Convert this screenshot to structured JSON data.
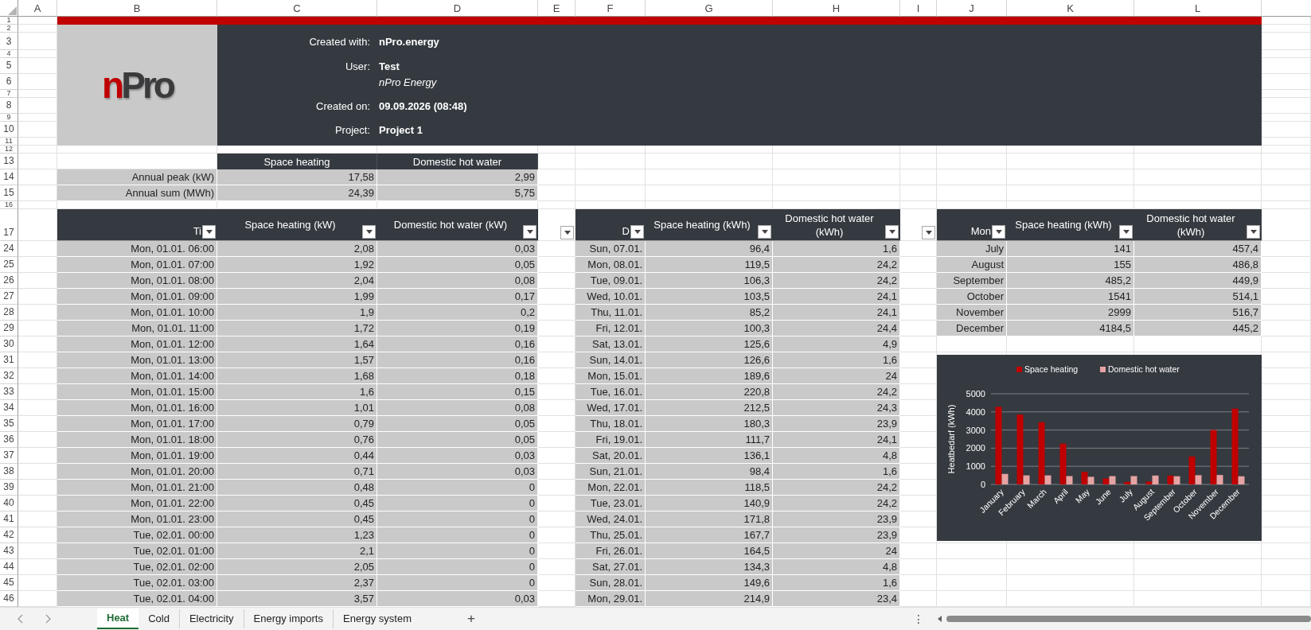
{
  "column_headers": [
    "A",
    "B",
    "C",
    "D",
    "E",
    "F",
    "G",
    "H",
    "I",
    "J",
    "K",
    "L"
  ],
  "row_numbers": [
    "1",
    "2",
    "3",
    "4",
    "5",
    "6",
    "7",
    "8",
    "9",
    "10",
    "11",
    "12",
    "13",
    "14",
    "15",
    "16",
    "17",
    "24",
    "25",
    "26",
    "27",
    "28",
    "29",
    "30",
    "31",
    "32",
    "33",
    "34",
    "35",
    "36",
    "37",
    "38",
    "39",
    "40",
    "41",
    "42",
    "43",
    "44",
    "45",
    "46"
  ],
  "logo": {
    "accent": "n",
    "rest": "Pro"
  },
  "info": [
    {
      "kind": "field",
      "label": "Created with:",
      "value": "nPro.energy"
    },
    {
      "kind": "field",
      "label": "User:",
      "value": "Test"
    },
    {
      "kind": "note",
      "value": "nPro Energy"
    },
    {
      "kind": "field",
      "label": "Created on:",
      "value": "09.09.2026 (08:48)"
    },
    {
      "kind": "field",
      "label": "Project:",
      "value": "Project 1"
    }
  ],
  "summary": {
    "columns": [
      "Space heating",
      "Domestic hot water"
    ],
    "rows": [
      {
        "label": "Annual peak (kW)",
        "values": [
          "17,58",
          "2,99"
        ]
      },
      {
        "label": "Annual sum (MWh)",
        "values": [
          "24,39",
          "5,75"
        ]
      }
    ]
  },
  "tables": [
    {
      "columns": [
        {
          "kind": "header",
          "label": "Ti"
        },
        {
          "kind": "header",
          "label": "Space heating (kW)"
        },
        {
          "kind": "header",
          "label": "Domestic hot water (kW)"
        },
        {
          "kind": "filter"
        }
      ],
      "rows": [
        [
          "Mon, 01.01. 06:00",
          "2,08",
          "0,03"
        ],
        [
          "Mon, 01.01. 07:00",
          "1,92",
          "0,05"
        ],
        [
          "Mon, 01.01. 08:00",
          "2,04",
          "0,08"
        ],
        [
          "Mon, 01.01. 09:00",
          "1,99",
          "0,17"
        ],
        [
          "Mon, 01.01. 10:00",
          "1,9",
          "0,2"
        ],
        [
          "Mon, 01.01. 11:00",
          "1,72",
          "0,19"
        ],
        [
          "Mon, 01.01. 12:00",
          "1,64",
          "0,16"
        ],
        [
          "Mon, 01.01. 13:00",
          "1,57",
          "0,16"
        ],
        [
          "Mon, 01.01. 14:00",
          "1,68",
          "0,18"
        ],
        [
          "Mon, 01.01. 15:00",
          "1,6",
          "0,15"
        ],
        [
          "Mon, 01.01. 16:00",
          "1,01",
          "0,08"
        ],
        [
          "Mon, 01.01. 17:00",
          "0,79",
          "0,05"
        ],
        [
          "Mon, 01.01. 18:00",
          "0,76",
          "0,05"
        ],
        [
          "Mon, 01.01. 19:00",
          "0,44",
          "0,03"
        ],
        [
          "Mon, 01.01. 20:00",
          "0,71",
          "0,03"
        ],
        [
          "Mon, 01.01. 21:00",
          "0,48",
          "0"
        ],
        [
          "Mon, 01.01. 22:00",
          "0,45",
          "0"
        ],
        [
          "Mon, 01.01. 23:00",
          "0,45",
          "0"
        ],
        [
          "Tue, 02.01. 00:00",
          "1,23",
          "0"
        ],
        [
          "Tue, 02.01. 01:00",
          "2,1",
          "0"
        ],
        [
          "Tue, 02.01. 02:00",
          "2,05",
          "0"
        ],
        [
          "Tue, 02.01. 03:00",
          "2,37",
          "0"
        ],
        [
          "Tue, 02.01. 04:00",
          "3,57",
          "0,03"
        ]
      ]
    },
    {
      "columns": [
        {
          "kind": "header",
          "label": "D"
        },
        {
          "kind": "header",
          "label": "Space heating (kWh)"
        },
        {
          "kind": "header",
          "label": "Domestic hot water (kWh)"
        },
        {
          "kind": "filter"
        }
      ],
      "rows": [
        [
          "Sun, 07.01.",
          "96,4",
          "1,6"
        ],
        [
          "Mon, 08.01.",
          "119,5",
          "24,2"
        ],
        [
          "Tue, 09.01.",
          "106,3",
          "24,2"
        ],
        [
          "Wed, 10.01.",
          "103,5",
          "24,1"
        ],
        [
          "Thu, 11.01.",
          "85,2",
          "24,1"
        ],
        [
          "Fri, 12.01.",
          "100,3",
          "24,4"
        ],
        [
          "Sat, 13.01.",
          "125,6",
          "4,9"
        ],
        [
          "Sun, 14.01.",
          "126,6",
          "1,6"
        ],
        [
          "Mon, 15.01.",
          "189,6",
          "24"
        ],
        [
          "Tue, 16.01.",
          "220,8",
          "24,2"
        ],
        [
          "Wed, 17.01.",
          "212,5",
          "24,3"
        ],
        [
          "Thu, 18.01.",
          "180,3",
          "23,9"
        ],
        [
          "Fri, 19.01.",
          "111,7",
          "24,1"
        ],
        [
          "Sat, 20.01.",
          "136,1",
          "4,8"
        ],
        [
          "Sun, 21.01.",
          "98,4",
          "1,6"
        ],
        [
          "Mon, 22.01.",
          "118,5",
          "24,2"
        ],
        [
          "Tue, 23.01.",
          "140,9",
          "24,2"
        ],
        [
          "Wed, 24.01.",
          "171,8",
          "23,9"
        ],
        [
          "Thu, 25.01.",
          "167,7",
          "23,9"
        ],
        [
          "Fri, 26.01.",
          "164,5",
          "24"
        ],
        [
          "Sat, 27.01.",
          "134,3",
          "4,8"
        ],
        [
          "Sun, 28.01.",
          "149,6",
          "1,6"
        ],
        [
          "Mon, 29.01.",
          "214,9",
          "23,4"
        ]
      ]
    },
    {
      "columns": [
        {
          "kind": "header",
          "label": "Mon"
        },
        {
          "kind": "header",
          "label": "Space heating (kWh)"
        },
        {
          "kind": "header",
          "label": "Domestic hot water (kWh)"
        }
      ],
      "rows": [
        [
          "July",
          "141",
          "457,4"
        ],
        [
          "August",
          "155",
          "486,8"
        ],
        [
          "September",
          "485,2",
          "449,9"
        ],
        [
          "October",
          "1541",
          "514,1"
        ],
        [
          "November",
          "2999",
          "516,7"
        ],
        [
          "December",
          "4184,5",
          "445,2"
        ]
      ]
    }
  ],
  "chart": {
    "chart_data": {
      "type": "bar",
      "ylabel": "Heatbedarf (kWh)",
      "grid": true,
      "legend": true,
      "categories": [
        "January",
        "February",
        "March",
        "April",
        "May",
        "June",
        "July",
        "August",
        "September",
        "October",
        "November",
        "December"
      ],
      "series": [
        {
          "name": "Space heating",
          "color": "#c00000",
          "values": [
            4280,
            3850,
            3430,
            2250,
            690,
            330,
            140,
            160,
            490,
            1540,
            3000,
            4180
          ]
        },
        {
          "name": "Domestic hot water",
          "color": "#e6a3a3",
          "values": [
            580,
            500,
            500,
            460,
            420,
            460,
            460,
            490,
            450,
            510,
            520,
            450
          ]
        }
      ],
      "ylim": [
        0,
        5000
      ],
      "yticks": [
        0,
        1000,
        2000,
        3000,
        4000,
        5000
      ]
    }
  },
  "sheet_tabs": [
    {
      "label": "Heat",
      "selected": true
    },
    {
      "label": "Cold",
      "selected": false
    },
    {
      "label": "Electricity",
      "selected": false
    },
    {
      "label": "Energy imports",
      "selected": false
    },
    {
      "label": "Energy system",
      "selected": false
    }
  ],
  "add_sheet": "+",
  "more_menu": "⋮"
}
